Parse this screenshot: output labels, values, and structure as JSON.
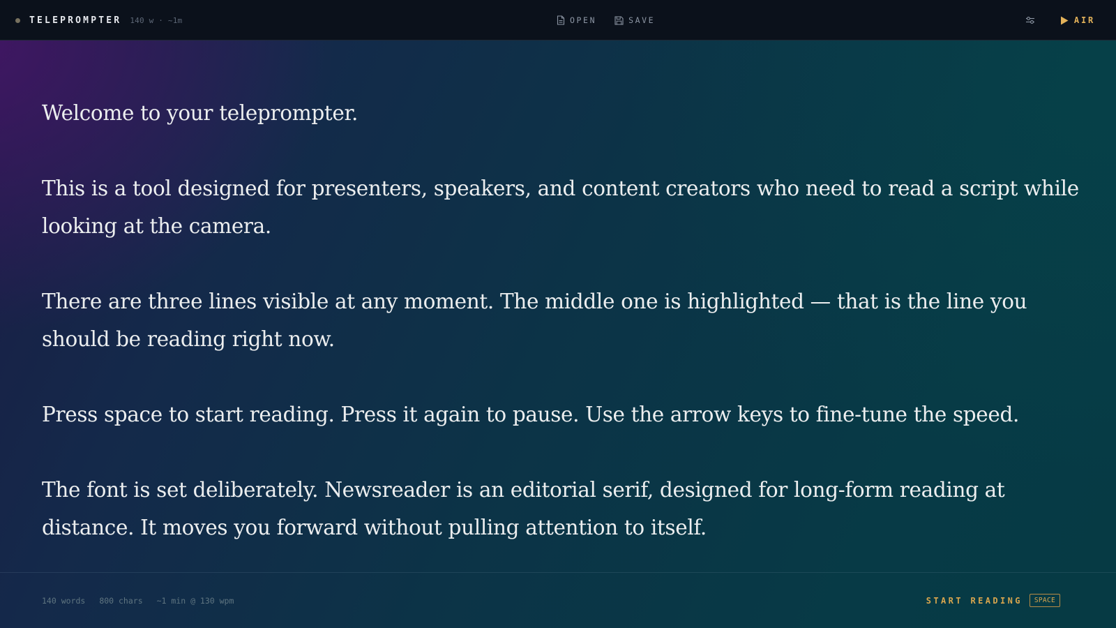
{
  "header": {
    "app_title": "TELEPROMPTER",
    "stats": "140 w · ~1m",
    "open_label": "OPEN",
    "save_label": "SAVE",
    "air_label": "AIR",
    "icons": {
      "status": "status-dot",
      "open": "file-icon",
      "save": "floppy-disk-icon",
      "settings": "sliders-icon",
      "air": "play-icon"
    }
  },
  "script": {
    "paragraphs": [
      "Welcome to your teleprompter.",
      "This is a tool designed for presenters, speakers, and content creators who need to read a script while looking at the camera.",
      "There are three lines visible at any moment. The middle one is highlighted — that is the line you should be reading right now.",
      "Press space to start reading. Press it again to pause. Use the arrow keys to fine-tune the speed.",
      "The font is set deliberately. Newsreader is an editorial serif, designed for long-form reading at distance. It moves you forward without pulling attention to itself."
    ]
  },
  "footer": {
    "words": "140 words",
    "chars": "800 chars",
    "duration": "~1 min @ 130 wpm",
    "start_label": "START READING",
    "shortcut": "SPACE"
  },
  "colors": {
    "accent": "#e3b25a",
    "topbar_bg": "#0b111b",
    "text": "#eceeef",
    "muted": "#5f7580"
  }
}
